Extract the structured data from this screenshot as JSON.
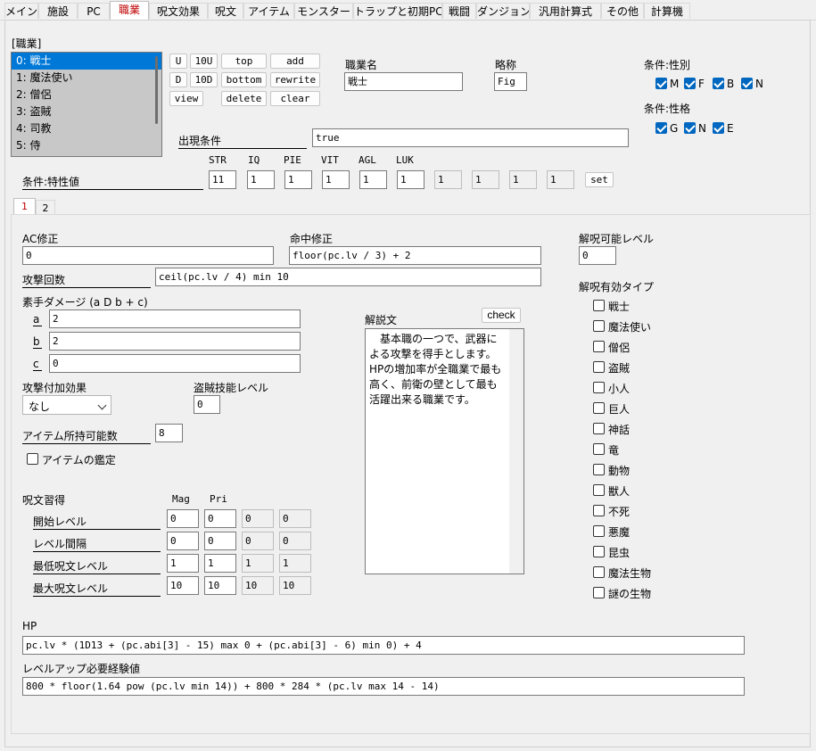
{
  "tabs": [
    "メイン",
    "施設",
    "PC",
    "職業",
    "呪文効果",
    "呪文",
    "アイテム",
    "モンスター",
    "トラップと初期PC",
    "戦闘",
    "ダンジョン",
    "汎用計算式",
    "その他",
    "計算機"
  ],
  "section_label": "[職業]",
  "job_list": [
    "0: 戦士",
    "1: 魔法使い",
    "2: 僧侶",
    "3: 盗賊",
    "4: 司教",
    "5: 侍"
  ],
  "list_buttons": {
    "u": "U",
    "u10": "10U",
    "top": "top",
    "add": "add",
    "d": "D",
    "d10": "10D",
    "bottom": "bottom",
    "rewrite": "rewrite",
    "view": "view",
    "delete": "delete",
    "clear": "clear"
  },
  "job_name": {
    "label": "職業名",
    "value": "戦士"
  },
  "abbrev": {
    "label": "略称",
    "value": "Fig"
  },
  "cond_gender": {
    "label": "条件:性別",
    "items": [
      "M",
      "F",
      "B",
      "N"
    ]
  },
  "cond_align": {
    "label": "条件:性格",
    "items": [
      "G",
      "N",
      "E"
    ]
  },
  "appear": {
    "label": "出現条件",
    "value": "true"
  },
  "stats": {
    "label": "条件:特性値",
    "headers": [
      "STR",
      "IQ",
      "PIE",
      "VIT",
      "AGL",
      "LUK"
    ],
    "values": [
      "11",
      "1",
      "1",
      "1",
      "1",
      "1",
      "1",
      "1",
      "1",
      "1"
    ],
    "set": "set"
  },
  "subtabs": [
    "1",
    "2"
  ],
  "ac": {
    "label": "AC修正",
    "value": "0"
  },
  "hit": {
    "label": "命中修正",
    "value": "floor(pc.lv / 3) + 2"
  },
  "uncurse_level": {
    "label": "解呪可能レベル",
    "value": "0"
  },
  "attacks": {
    "label": "攻撃回数",
    "value": "ceil(pc.lv / 4) min 10"
  },
  "bare": {
    "label": "素手ダメージ (a D b + c)",
    "a_label": "a",
    "a": "2",
    "b_label": "b",
    "b": "2",
    "c_label": "c",
    "c": "0"
  },
  "attack_effect": {
    "label": "攻撃付加効果",
    "value": "なし"
  },
  "thief_level": {
    "label": "盗賊技能レベル",
    "value": "0"
  },
  "item_capacity": {
    "label": "アイテム所持可能数",
    "value": "8"
  },
  "item_identify": "アイテムの鑑定",
  "spell": {
    "label": "呪文習得",
    "mag": "Mag",
    "pri": "Pri",
    "rows": [
      {
        "label": "開始レベル",
        "values": [
          "0",
          "0",
          "0",
          "0"
        ]
      },
      {
        "label": "レベル間隔",
        "values": [
          "0",
          "0",
          "0",
          "0"
        ]
      },
      {
        "label": "最低呪文レベル",
        "values": [
          "1",
          "1",
          "1",
          "1"
        ]
      },
      {
        "label": "最大呪文レベル",
        "values": [
          "10",
          "10",
          "10",
          "10"
        ]
      }
    ]
  },
  "description": {
    "label": "解説文",
    "check": "check",
    "text": "　基本職の一つで、武器による攻撃を得手とします。HPの増加率が全職業で最も高く、前衛の壁として最も活躍出来る職業です。"
  },
  "uncurse_types": {
    "label": "解呪有効タイプ",
    "items": [
      "戦士",
      "魔法使い",
      "僧侶",
      "盗賊",
      "小人",
      "巨人",
      "神話",
      "竜",
      "動物",
      "獣人",
      "不死",
      "悪魔",
      "昆虫",
      "魔法生物",
      "謎の生物"
    ]
  },
  "hp": {
    "label": "HP",
    "value": "pc.lv * (1D13 + (pc.abi[3] - 15) max 0 + (pc.abi[3] - 6) min 0) + 4"
  },
  "exp": {
    "label": "レベルアップ必要経験値",
    "value": "800 * floor(1.64 pow (pc.lv min 14)) + 800 * 284 * (pc.lv max 14 - 14)"
  }
}
